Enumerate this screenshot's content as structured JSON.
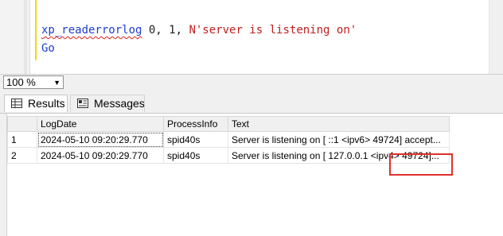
{
  "editor": {
    "line1": {
      "func": "xp_readerrorlog",
      "args": " 0, 1, ",
      "string": "N'server is listening on'"
    },
    "line2": "Go"
  },
  "zoom": {
    "value": "100 %"
  },
  "tabs": [
    {
      "label": "Results",
      "icon": "grid-icon"
    },
    {
      "label": "Messages",
      "icon": "messages-icon"
    }
  ],
  "results": {
    "columns": [
      "LogDate",
      "ProcessInfo",
      "Text"
    ],
    "rows": [
      {
        "num": "1",
        "logdate": "2024-05-10 09:20:29.770",
        "process": "spid40s",
        "text": "Server is listening on [ ::1 <ipv6> 49724] accept..."
      },
      {
        "num": "2",
        "logdate": "2024-05-10 09:20:29.770",
        "process": "spid40s",
        "text": "Server is listening on [ 127.0.0.1 <ipv4> 49724]..."
      }
    ]
  },
  "colors": {
    "highlight": "#e0302a",
    "string": "#c21e1e",
    "keyword": "#1d3dd1"
  }
}
